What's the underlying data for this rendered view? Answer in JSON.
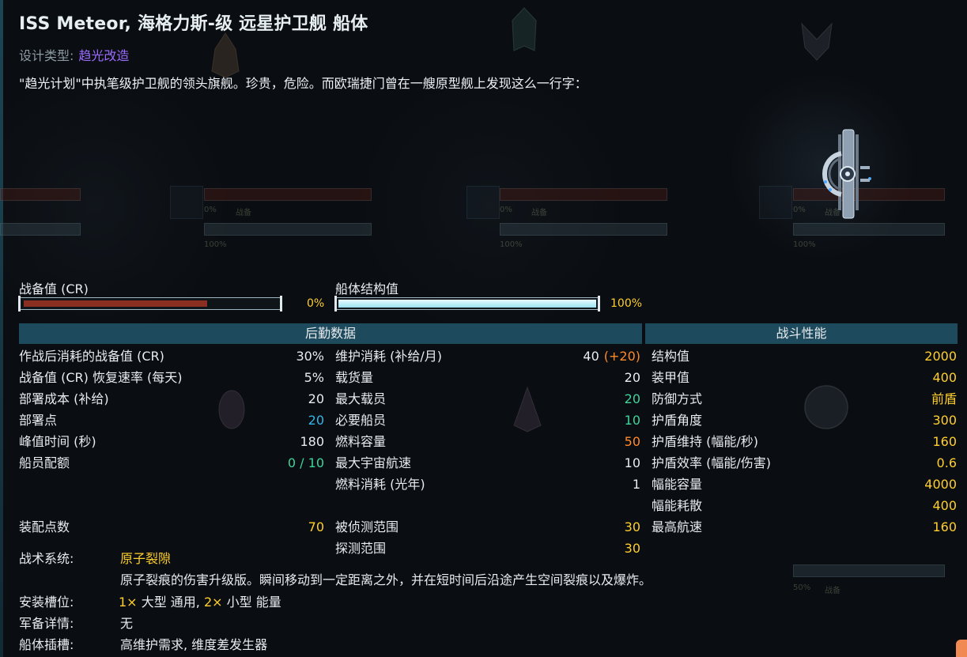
{
  "header": {
    "title": "ISS Meteor, 海格力斯-级 远星护卫舰 船体",
    "design_label": "设计类型:",
    "design_value": "趋光改造",
    "description": "\"趋光计划\"中执笔级护卫舰的领头旗舰。珍贵，危险。而欧瑞捷门曾在一艘原型舰上发现这么一行字："
  },
  "bars": {
    "cr_label": "战备值 (CR)",
    "cr_value": 0,
    "cr_pct": "0%",
    "hull_label": "船体结构值",
    "hull_value": 100,
    "hull_pct": "100%"
  },
  "sections": {
    "logistics": "后勤数据",
    "combat": "战斗性能"
  },
  "logistics_col1": [
    {
      "label": "作战后消耗的战备值 (CR)",
      "value": "30%",
      "color": "default"
    },
    {
      "label": "战备值 (CR) 恢复速率 (每天)",
      "value": "5%",
      "color": "default"
    },
    {
      "label": "部署成本 (补给)",
      "value": "20",
      "color": "default"
    },
    {
      "label": "部署点",
      "value": "20",
      "color": "blue"
    },
    {
      "label": "峰值时间 (秒)",
      "value": "180",
      "color": "default"
    },
    {
      "label": "船员配额",
      "value": "0 / 10",
      "color": "green"
    }
  ],
  "fitting_points": {
    "label": "装配点数",
    "value": "70"
  },
  "logistics_col2": [
    {
      "label": "维护消耗 (补给/月)",
      "value": "40",
      "extra": "(+20)",
      "color": "default"
    },
    {
      "label": "载货量",
      "value": "20",
      "color": "default"
    },
    {
      "label": "最大载员",
      "value": "20",
      "color": "green"
    },
    {
      "label": "必要船员",
      "value": "10",
      "color": "green"
    },
    {
      "label": "燃料容量",
      "value": "50",
      "color": "orange"
    },
    {
      "label": "最大宇宙航速",
      "value": "10",
      "color": "default"
    },
    {
      "label": "燃料消耗 (光年)",
      "value": "1",
      "color": "default"
    }
  ],
  "logistics_col2_bottom": [
    {
      "label": "被侦测范围",
      "value": "30"
    },
    {
      "label": "探测范围",
      "value": "30"
    }
  ],
  "combat": [
    {
      "label": "结构值",
      "value": "2000"
    },
    {
      "label": "装甲值",
      "value": "400"
    },
    {
      "label": "防御方式",
      "value": "前盾"
    },
    {
      "label": "护盾角度",
      "value": "300"
    },
    {
      "label": "护盾维持 (幅能/秒)",
      "value": "160"
    },
    {
      "label": "护盾效率 (幅能/伤害)",
      "value": "0.6"
    },
    {
      "label": "幅能容量",
      "value": "4000"
    },
    {
      "label": "幅能耗散",
      "value": "400"
    },
    {
      "label": "最高航速",
      "value": "160"
    }
  ],
  "tactical": {
    "label": "战术系统:",
    "name": "原子裂隙",
    "desc": "原子裂痕的伤害升级版。瞬间移动到一定距离之外，并在短时间后沿途产生空间裂痕以及爆炸。"
  },
  "mounts": {
    "label": "安装槽位:",
    "n1": "1×",
    "t1": "大型 通用,",
    "n2": "2×",
    "t2": "小型 能量"
  },
  "armament": {
    "label": "军备详情:",
    "value": "无"
  },
  "hullmods": {
    "label": "船体插槽:",
    "value": "高维护需求, 维度差发生器"
  },
  "ghost": {
    "pct0": "0%",
    "pct100": "100%",
    "cr_word": "战备",
    "pct50": "50%"
  },
  "colors": {
    "accent_header": "#1d4a5c",
    "yellow": "#ffcf2e",
    "green": "#3fd49a",
    "blue": "#35b5e8",
    "orange": "#ff8a2a",
    "purple": "#9b6cff"
  }
}
